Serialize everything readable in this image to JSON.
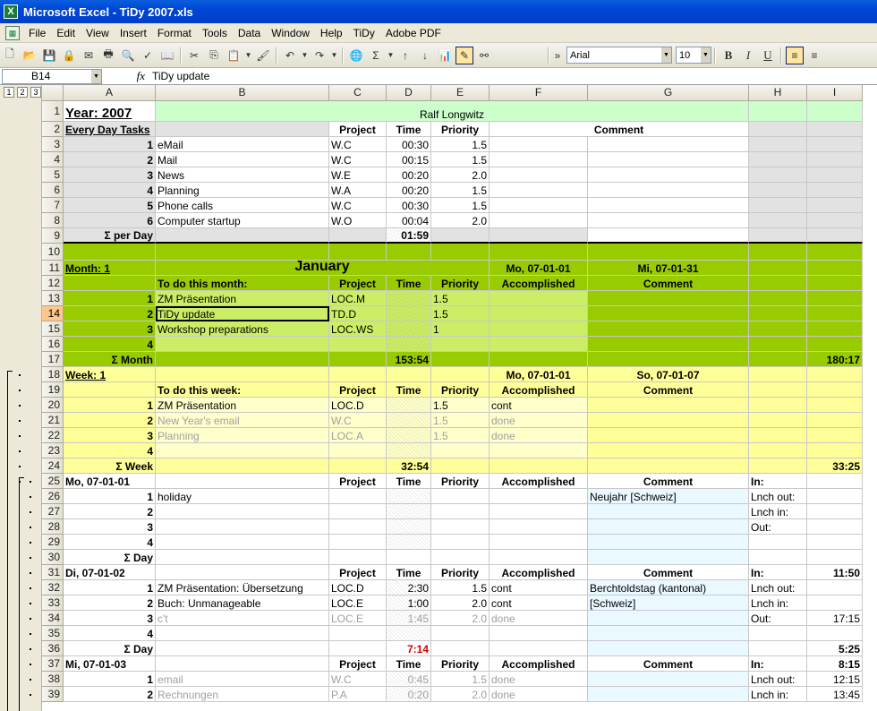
{
  "title": "Microsoft Excel - TiDy 2007.xls",
  "menu": [
    "File",
    "Edit",
    "View",
    "Insert",
    "Format",
    "Tools",
    "Data",
    "Window",
    "Help",
    "TiDy",
    "Adobe PDF"
  ],
  "toolbar": {
    "font": "Arial",
    "size": "10"
  },
  "formula": {
    "cell": "B14",
    "fx": "fx",
    "value": "TiDy update"
  },
  "outline_levels": [
    "1",
    "2",
    "3"
  ],
  "columns": [
    "A",
    "B",
    "C",
    "D",
    "E",
    "F",
    "G",
    "H",
    "I"
  ],
  "rows": [
    "1",
    "2",
    "3",
    "4",
    "5",
    "6",
    "7",
    "8",
    "9",
    "10",
    "11",
    "12",
    "13",
    "14",
    "15",
    "16",
    "17",
    "18",
    "19",
    "20",
    "21",
    "22",
    "23",
    "24",
    "25",
    "26",
    "27",
    "28",
    "29",
    "30",
    "31",
    "32",
    "33",
    "34",
    "35",
    "36",
    "37",
    "38",
    "39"
  ],
  "cells": {
    "r1": {
      "A": "Year:  2007",
      "B": "Ralf Longwitz"
    },
    "r2": {
      "A": "Every Day Tasks",
      "C": "Project",
      "D": "Time",
      "E": "Priority",
      "F": "Comment"
    },
    "r3": {
      "A": "1",
      "B": "eMail",
      "C": "W.C",
      "D": "00:30",
      "E": "1.5"
    },
    "r4": {
      "A": "2",
      "B": "Mail",
      "C": "W.C",
      "D": "00:15",
      "E": "1.5"
    },
    "r5": {
      "A": "3",
      "B": "News",
      "C": "W.E",
      "D": "00:20",
      "E": "2.0"
    },
    "r6": {
      "A": "4",
      "B": "Planning",
      "C": "W.A",
      "D": "00:20",
      "E": "1.5"
    },
    "r7": {
      "A": "5",
      "B": "Phone calls",
      "C": "W.C",
      "D": "00:30",
      "E": "1.5"
    },
    "r8": {
      "A": "6",
      "B": "Computer startup",
      "C": "W.O",
      "D": "00:04",
      "E": "2.0"
    },
    "r9": {
      "A": "Σ per Day",
      "D": "01:59"
    },
    "r11": {
      "A": "Month:  1",
      "B": "January",
      "F": "Mo, 07-01-01",
      "G": "Mi, 07-01-31"
    },
    "r12": {
      "B": "To do this month:",
      "C": "Project",
      "D": "Time",
      "E": "Priority",
      "F": "Accomplished",
      "G": "Comment"
    },
    "r13": {
      "A": "1",
      "B": "ZM Präsentation",
      "C": "LOC.M",
      "E": "1.5"
    },
    "r14": {
      "A": "2",
      "B": "TiDy update",
      "C": "TD.D",
      "E": "1.5"
    },
    "r15": {
      "A": "3",
      "B": "Workshop preparations",
      "C": "LOC.WS",
      "E": "1"
    },
    "r16": {
      "A": "4"
    },
    "r17": {
      "A": "Σ Month",
      "D": "153:54",
      "I": "180:17"
    },
    "r18": {
      "A": "Week: 1",
      "F": "Mo, 07-01-01",
      "G": "So, 07-01-07"
    },
    "r19": {
      "B": "To do this week:",
      "C": "Project",
      "D": "Time",
      "E": "Priority",
      "F": "Accomplished",
      "G": "Comment"
    },
    "r20": {
      "A": "1",
      "B": "ZM Präsentation",
      "C": "LOC.D",
      "E": "1.5",
      "F": "cont"
    },
    "r21": {
      "A": "2",
      "B": "New Year's email",
      "C": "W.C",
      "E": "1.5",
      "F": "done"
    },
    "r22": {
      "A": "3",
      "B": "Planning",
      "C": "LOC.A",
      "E": "1.5",
      "F": "done"
    },
    "r23": {
      "A": "4"
    },
    "r24": {
      "A": "Σ Week",
      "D": "32:54",
      "I": "33:25"
    },
    "r25": {
      "A": "Mo, 07-01-01",
      "C": "Project",
      "D": "Time",
      "E": "Priority",
      "F": "Accomplished",
      "G": "Comment",
      "H": "In:"
    },
    "r26": {
      "A": "1",
      "B": "holiday",
      "G": "Neujahr [Schweiz]",
      "H": "Lnch out:"
    },
    "r27": {
      "A": "2",
      "H": "Lnch in:"
    },
    "r28": {
      "A": "3",
      "H": "Out:"
    },
    "r29": {
      "A": "4"
    },
    "r30": {
      "A": "Σ Day"
    },
    "r31": {
      "A": "Di, 07-01-02",
      "C": "Project",
      "D": "Time",
      "E": "Priority",
      "F": "Accomplished",
      "G": "Comment",
      "H": "In:",
      "I": "11:50"
    },
    "r32": {
      "A": "1",
      "B": "ZM Präsentation: Übersetzung",
      "C": "LOC.D",
      "D": "2:30",
      "E": "1.5",
      "F": "cont",
      "G": "Berchtoldstag (kantonal)",
      "H": "Lnch out:"
    },
    "r33": {
      "A": "2",
      "B": "Buch: Unmanageable",
      "C": "LOC.E",
      "D": "1:00",
      "E": "2.0",
      "F": "cont",
      "G": "[Schweiz]",
      "H": "Lnch in:"
    },
    "r34": {
      "A": "3",
      "B": "c't",
      "C": "LOC.E",
      "D": "1:45",
      "E": "2.0",
      "F": "done",
      "H": "Out:",
      "I": "17:15"
    },
    "r35": {
      "A": "4"
    },
    "r36": {
      "A": "Σ Day",
      "D": "7:14",
      "I": "5:25"
    },
    "r37": {
      "A": "Mi, 07-01-03",
      "C": "Project",
      "D": "Time",
      "E": "Priority",
      "F": "Accomplished",
      "G": "Comment",
      "H": "In:",
      "I": "8:15"
    },
    "r38": {
      "A": "1",
      "B": "email",
      "C": "W.C",
      "D": "0:45",
      "E": "1.5",
      "F": "done",
      "H": "Lnch out:",
      "I": "12:15"
    },
    "r39": {
      "A": "2",
      "B": "Rechnungen",
      "C": "P.A",
      "D": "0:20",
      "E": "2.0",
      "F": "done",
      "H": "Lnch in:",
      "I": "13:45"
    }
  },
  "colors": {
    "green_light": "#ccffcc",
    "green": "#99cc00",
    "green_mid": "#ccee66",
    "yellow": "#ffff99",
    "yellow_light": "#ffffcc",
    "cyan": "#eaf8ff",
    "grey": "#e2e2e2"
  }
}
